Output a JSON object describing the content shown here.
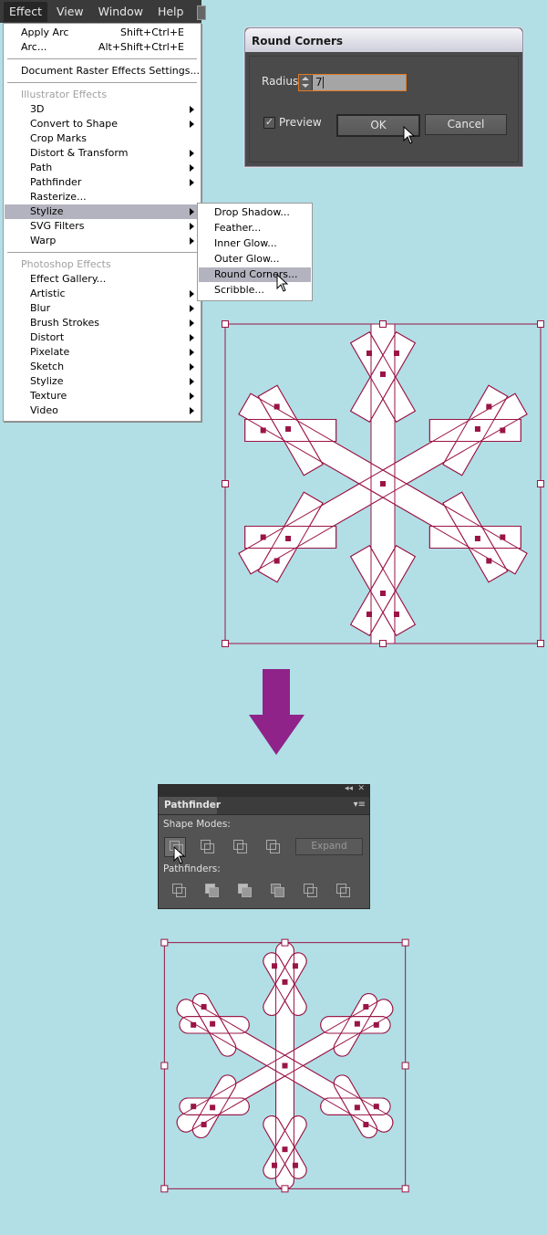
{
  "menubar": {
    "items": [
      "Effect",
      "View",
      "Window",
      "Help"
    ]
  },
  "effect_menu": {
    "apply_arc": {
      "label": "Apply Arc",
      "shortcut": "Shift+Ctrl+E"
    },
    "arc": {
      "label": "Arc...",
      "shortcut": "Alt+Shift+Ctrl+E"
    },
    "doc_raster": "Document Raster Effects Settings...",
    "illustrator_header": "Illustrator Effects",
    "illustrator_items": [
      {
        "label": "3D",
        "submenu": true
      },
      {
        "label": "Convert to Shape",
        "submenu": true
      },
      {
        "label": "Crop Marks",
        "submenu": false
      },
      {
        "label": "Distort & Transform",
        "submenu": true
      },
      {
        "label": "Path",
        "submenu": true
      },
      {
        "label": "Pathfinder",
        "submenu": true
      },
      {
        "label": "Rasterize...",
        "submenu": false
      },
      {
        "label": "Stylize",
        "submenu": true,
        "highlighted": true
      },
      {
        "label": "SVG Filters",
        "submenu": true
      },
      {
        "label": "Warp",
        "submenu": true
      }
    ],
    "photoshop_header": "Photoshop Effects",
    "photoshop_items": [
      {
        "label": "Effect Gallery...",
        "submenu": false
      },
      {
        "label": "Artistic",
        "submenu": true
      },
      {
        "label": "Blur",
        "submenu": true
      },
      {
        "label": "Brush Strokes",
        "submenu": true
      },
      {
        "label": "Distort",
        "submenu": true
      },
      {
        "label": "Pixelate",
        "submenu": true
      },
      {
        "label": "Sketch",
        "submenu": true
      },
      {
        "label": "Stylize",
        "submenu": true
      },
      {
        "label": "Texture",
        "submenu": true
      },
      {
        "label": "Video",
        "submenu": true
      }
    ]
  },
  "stylize_submenu": {
    "items": [
      "Drop Shadow...",
      "Feather...",
      "Inner Glow...",
      "Outer Glow...",
      "Round Corners...",
      "Scribble..."
    ],
    "highlighted_index": 4
  },
  "dialog": {
    "title": "Round Corners",
    "radius_label": "Radius:",
    "radius_value": "7",
    "preview_label": "Preview",
    "preview_checked": true,
    "preview_mark": "✓",
    "ok_label": "OK",
    "cancel_label": "Cancel"
  },
  "pathfinder_panel": {
    "collapse_icon": "◂◂",
    "close_icon": "✕",
    "tab_label": "Pathfinder",
    "menu_icon": "▾≡",
    "shape_modes_label": "Shape Modes:",
    "shape_modes": [
      "unite",
      "minus-front",
      "intersect",
      "exclude"
    ],
    "selected_shape_mode": "unite",
    "expand_label": "Expand",
    "pathfinders_label": "Pathfinders:",
    "pathfinders": [
      "divide",
      "trim",
      "merge",
      "crop",
      "outline",
      "minus-back"
    ]
  },
  "colors": {
    "background": "#b1dfe5",
    "selection": "#9a1446",
    "arrow": "#8f2389",
    "dialog_focus": "#e07a25"
  }
}
